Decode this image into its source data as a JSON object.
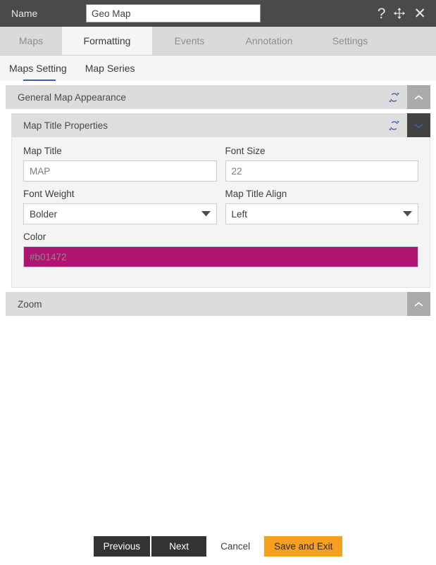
{
  "titlebar": {
    "name_label": "Name",
    "name_value": "Geo Map",
    "name_placeholder": "Name",
    "help_icon": "?",
    "move_icon": "move-icon",
    "close_icon": "✕"
  },
  "tabs": [
    {
      "label": "Maps",
      "active": false
    },
    {
      "label": "Formatting",
      "active": true
    },
    {
      "label": "Events",
      "active": false
    },
    {
      "label": "Annotation",
      "active": false
    },
    {
      "label": "Settings",
      "active": false
    }
  ],
  "subtabs": [
    {
      "label": "Maps Setting",
      "active": true
    },
    {
      "label": "Map Series",
      "active": false
    }
  ],
  "panels": {
    "general": {
      "title": "General Map Appearance",
      "expanded": false
    },
    "map_title": {
      "title": "Map Title Properties",
      "expanded": true,
      "fields": {
        "map_title": {
          "label": "Map Title",
          "value": "MAP",
          "placeholder": "MAP"
        },
        "font_size": {
          "label": "Font Size",
          "value": "22",
          "placeholder": "Font Size"
        },
        "font_weight": {
          "label": "Font Weight",
          "value": "Bolder"
        },
        "map_title_align": {
          "label": "Map Title Align",
          "value": "Left"
        },
        "color": {
          "label": "Color",
          "value": "#b01472",
          "swatch_hex": "#b01472"
        }
      }
    },
    "zoom": {
      "title": "Zoom",
      "expanded": false
    }
  },
  "footer": {
    "previous": "Previous",
    "next": "Next",
    "cancel": "Cancel",
    "save_and_exit": "Save and Exit"
  },
  "theme": {
    "titlebar_bg": "#4a4a4a",
    "tabstrip_bg": "#dadada",
    "accent_orange": "#f5a01e",
    "accent_blue": "#3b5fb0",
    "panel_header_bg": "#dcdcdc"
  }
}
